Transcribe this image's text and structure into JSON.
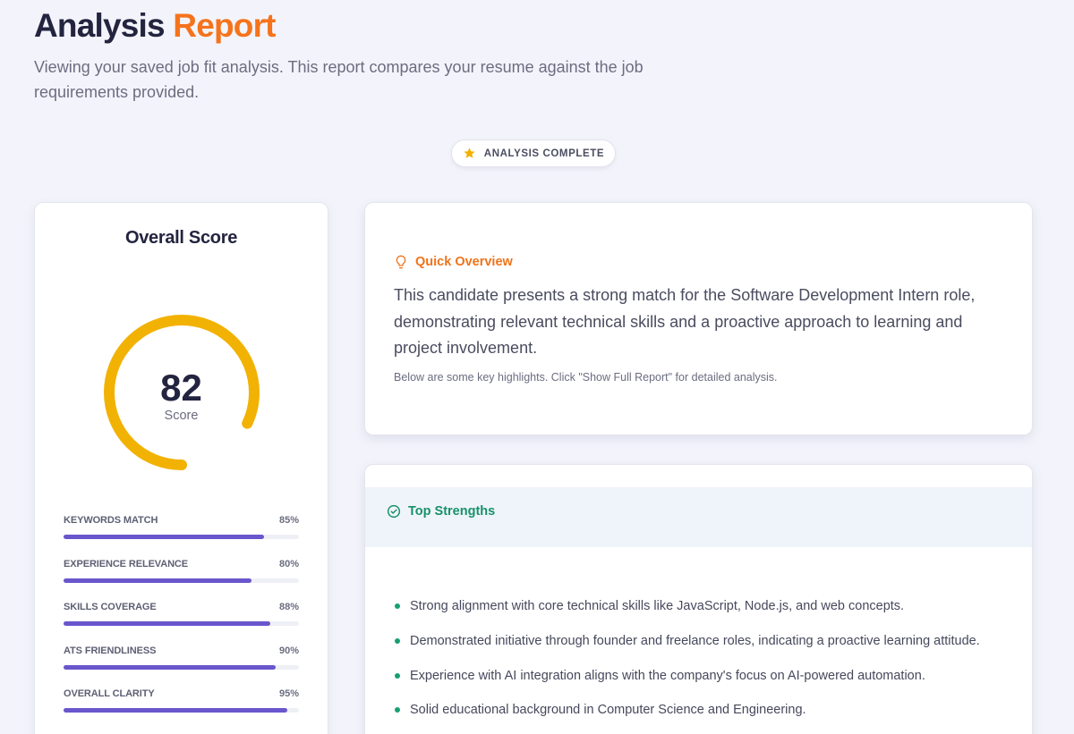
{
  "header": {
    "title_part1": "Analysis",
    "title_part2": "Report",
    "subtitle": "Viewing your saved job fit analysis. This report compares your resume against the job requirements provided."
  },
  "status": {
    "label": "ANALYSIS COMPLETE",
    "icon": "star-icon"
  },
  "score_card": {
    "title": "Overall Score",
    "score": 82,
    "score_label": "Score",
    "metrics": [
      {
        "name": "KEYWORDS MATCH",
        "percent_text": "85%",
        "value": 85
      },
      {
        "name": "EXPERIENCE RELEVANCE",
        "percent_text": "80%",
        "value": 80
      },
      {
        "name": "SKILLS COVERAGE",
        "percent_text": "88%",
        "value": 88
      },
      {
        "name": "ATS FRIENDLINESS",
        "percent_text": "90%",
        "value": 90
      },
      {
        "name": "OVERALL CLARITY",
        "percent_text": "95%",
        "value": 95
      }
    ]
  },
  "overview": {
    "heading": "Quick Overview",
    "icon": "lightbulb-icon",
    "text": "This candidate presents a strong match for the Software Development Intern role, demonstrating relevant technical skills and a proactive approach to learning and project involvement.",
    "note": "Below are some key highlights. Click \"Show Full Report\" for detailed analysis."
  },
  "strengths": {
    "heading": "Top Strengths",
    "icon": "check-circle-icon",
    "items": [
      "Strong alignment with core technical skills like JavaScript, Node.js, and web concepts.",
      "Demonstrated initiative through founder and freelance roles, indicating a proactive learning attitude.",
      "Experience with AI integration aligns with the company's focus on AI-powered automation.",
      "Solid educational background in Computer Science and Engineering."
    ]
  },
  "colors": {
    "accent": "#f5731c",
    "gauge": "#f2b203",
    "bar": "#6a56cc",
    "success": "#179168"
  }
}
